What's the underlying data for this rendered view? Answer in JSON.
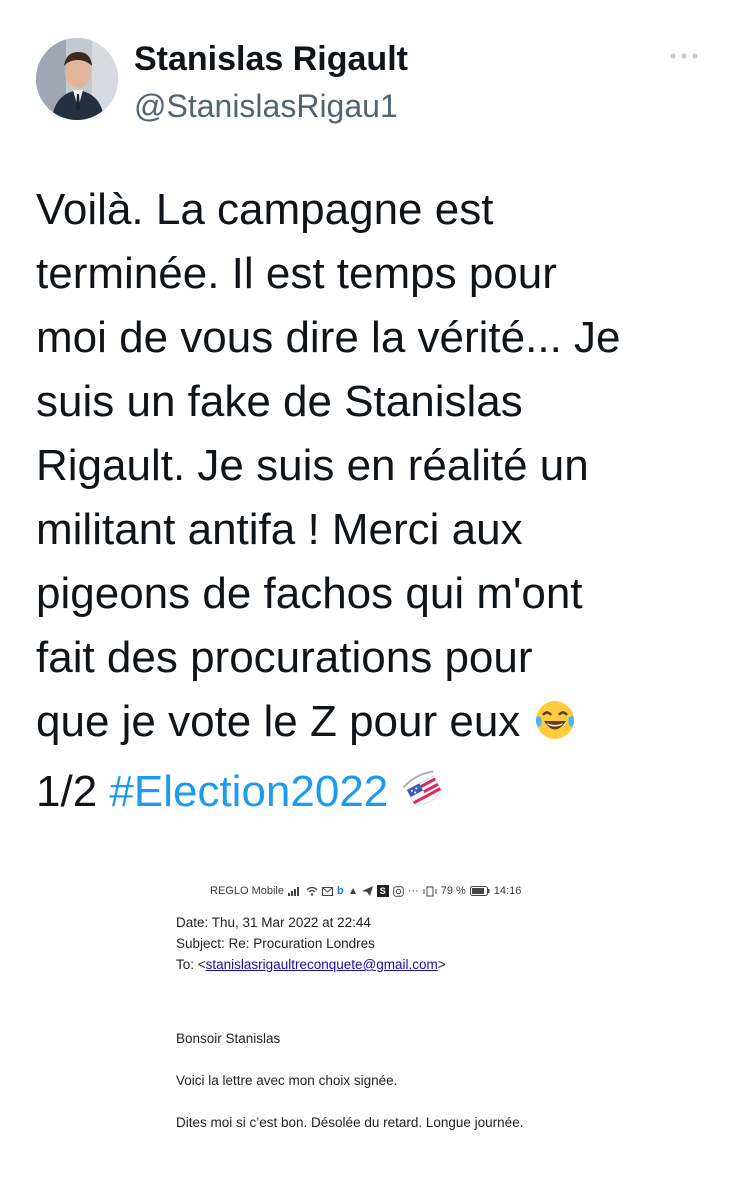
{
  "tweet": {
    "author_name": "Stanislas Rigault",
    "author_handle": "@StanislasRigau1",
    "more_icon": "more-dots-icon",
    "text_lines": [
      "Voilà. La campagne est",
      "terminée. Il est temps pour",
      "moi de vous dire la vérité... Je",
      "suis un fake de Stanislas",
      "Rigault. Je suis en réalité un",
      "militant antifa ! Merci aux",
      "pigeons de fachos qui m'ont",
      "fait des procurations pour",
      "que je vote le Z pour eux "
    ],
    "last_line_prefix": "1/2 ",
    "hashtag": "#Election2022",
    "emoji_laugh": "laughing-tears-emoji",
    "emoji_ballot": "ballot-hashflag-icon",
    "hashtag_color": "#1d9bf0"
  },
  "screenshot": {
    "statusbar": {
      "carrier": "REGLO Mobile",
      "battery": "79 %",
      "time": "14:16"
    },
    "email": {
      "date": "Date: Thu, 31 Mar 2022 at 22:44",
      "subject": "Subject: Re: Procuration Londres",
      "to_prefix": "To: <",
      "to_address": "stanislasrigaultreconquete@gmail.com",
      "to_suffix": ">",
      "greeting": "Bonsoir Stanislas",
      "paragraph1": "Voici la lettre avec mon choix signée.",
      "paragraph2": "Dites moi si c’est bon. Désolée du retard. Longue journée."
    }
  }
}
